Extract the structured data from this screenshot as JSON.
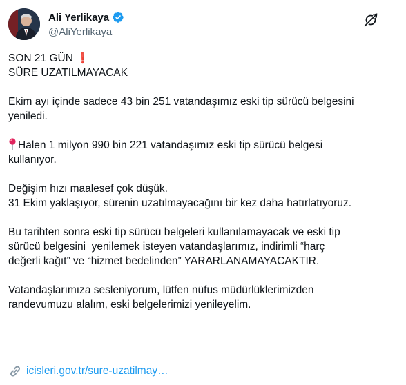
{
  "author": {
    "display_name": "Ali Yerlikaya",
    "handle": "@AliYerlikaya",
    "verified": true
  },
  "icons": {
    "verified": "verified-badge-icon",
    "grok": "grok-icon",
    "pin": "round-pushpin-icon",
    "exclamation": "red-exclamation-icon",
    "link": "link-icon"
  },
  "tweet": {
    "p1": {
      "line1_text": "SON 21 GÜN",
      "line1_emoji": "❗",
      "line2": "SÜRE UZATILMAYACAK"
    },
    "p2": {
      "line1": "Ekim ayı içinde sadece 43 bin 251 vatandaşımız eski tip sürücü belgesini",
      "line2": "yeniledi."
    },
    "p3": {
      "line1": "Halen 1 milyon 990 bin 221 vatandaşımız eski tip sürücü belgesi",
      "line2": "kullanıyor."
    },
    "p4": {
      "line1": "Değişim hızı maalesef çok düşük.",
      "line2": "31 Ekim yaklaşıyor, sürenin uzatılmayacağını bir kez daha hatırlatıyoruz."
    },
    "p5": {
      "line1": "Bu tarihten sonra eski tip sürücü belgeleri kullanılamayacak ve eski tip",
      "line2": "sürücü belgesini  yenilemek isteyen vatandaşlarımız, indirimli “harç",
      "line3": "değerli kağıt” ve “hizmet bedelinden” YARARLANAMAYACAKTIR."
    },
    "p6": {
      "line1": "Vatandaşlarımıza sesleniyorum, lütfen nüfus müdürlüklerimizden",
      "line2": "randevumuzu alalım, eski belgelerimizi yenileyelim."
    },
    "link_text": "icisleri.gov.tr/sure-uzatilmay…"
  },
  "colors": {
    "link": "#1d9bf0",
    "verified": "#1d9bf0",
    "text": "#0f1419",
    "secondary": "#536471"
  }
}
